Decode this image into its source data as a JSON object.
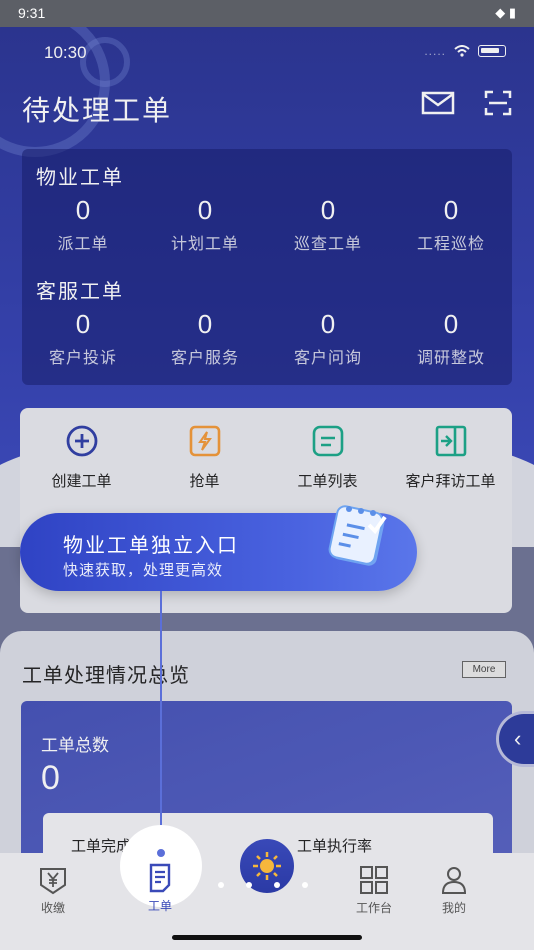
{
  "system_status": {
    "time": "9:31",
    "icons": "◆ ▮"
  },
  "inner_status": {
    "time": "10:30",
    "signal": "....."
  },
  "header": {
    "title": "待处理工单"
  },
  "stats": {
    "groups": [
      {
        "title": "物业工单",
        "items": [
          {
            "value": "0",
            "label": "派工单"
          },
          {
            "value": "0",
            "label": "计划工单"
          },
          {
            "value": "0",
            "label": "巡查工单"
          },
          {
            "value": "0",
            "label": "工程巡检"
          }
        ]
      },
      {
        "title": "客服工单",
        "items": [
          {
            "value": "0",
            "label": "客户投诉"
          },
          {
            "value": "0",
            "label": "客户服务"
          },
          {
            "value": "0",
            "label": "客户问询"
          },
          {
            "value": "0",
            "label": "调研整改"
          }
        ]
      }
    ]
  },
  "actions": [
    {
      "label": "创建工单",
      "icon": "plus-circle-icon"
    },
    {
      "label": "抢单",
      "icon": "lightning-icon"
    },
    {
      "label": "工单列表",
      "icon": "list-icon"
    },
    {
      "label": "客户拜访工单",
      "icon": "visit-door-icon"
    }
  ],
  "tooltip": {
    "title": "物业工单独立入口",
    "subtitle": "快速获取，处理更高效"
  },
  "overview": {
    "title": "工单处理情况总览",
    "more_label": "More",
    "total_label": "工单总数",
    "total_value": "0",
    "completion_label": "工单完成率",
    "execution_label": "工单执行率"
  },
  "side_tab": {
    "icon": "chevron-left-icon",
    "glyph": "‹"
  },
  "tabbar": [
    {
      "label": "收缴",
      "icon": "yen-box-icon"
    },
    {
      "label": "工单",
      "icon": "document-icon"
    },
    {
      "label": "",
      "icon": "sun-icon"
    },
    {
      "label": "工作台",
      "icon": "grid-icon"
    },
    {
      "label": "我的",
      "icon": "person-icon"
    }
  ],
  "colors": {
    "primary": "#2f3ea8",
    "accent": "#f29a38",
    "teal": "#1aa98a",
    "highlight": "#5b6fd9"
  }
}
